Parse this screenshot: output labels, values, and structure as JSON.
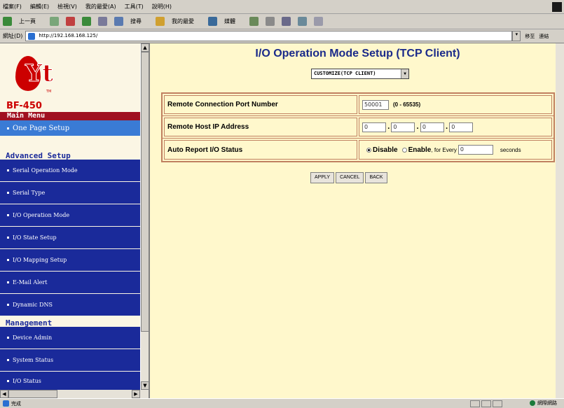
{
  "browser": {
    "menu_items": [
      "檔案(F)",
      "編輯(E)",
      "檢視(V)",
      "我的最愛(A)",
      "工具(T)",
      "說明(H)"
    ],
    "toolbar_back": "上一頁",
    "toolbar_items": [
      "搜尋",
      "我的最愛",
      "媒體"
    ],
    "address_label": "網址(D)",
    "address_url": "http://192.168.168.125/",
    "go_label": "移至",
    "links_label": "連結",
    "status_text": "完成",
    "zone_text": "網際網路"
  },
  "sidebar": {
    "logo_text": "Yt",
    "logo_tm": "TM",
    "model": "BF-450",
    "main_menu_label": "Main Menu",
    "main_items": [
      {
        "label": "One Page Setup"
      }
    ],
    "advanced_heading": "Advanced Setup",
    "advanced_items": [
      {
        "label": "Serial Operation Mode"
      },
      {
        "label": "Serial Type"
      },
      {
        "label": "I/O Operation Mode"
      },
      {
        "label": "I/O State Setup"
      },
      {
        "label": "I/O Mapping Setup"
      },
      {
        "label": "E-Mail Alert"
      },
      {
        "label": "Dynamic DNS"
      }
    ],
    "management_heading": "Management",
    "management_items": [
      {
        "label": "Device Admin"
      },
      {
        "label": "System Status"
      },
      {
        "label": "I/O Status"
      }
    ]
  },
  "main": {
    "title": "I/O Operation Mode Setup (TCP Client)",
    "mode_select": "CUSTOMIZE(TCP CLIENT)",
    "rows": {
      "port_label": "Remote Connection Port Number",
      "port_value": "50001",
      "port_range": "(0 - 65535)",
      "ip_label": "Remote Host  IP Address",
      "ip_octets": [
        "0",
        "0",
        "0",
        "0"
      ],
      "auto_label": "Auto Report I/O Status",
      "disable_label": "Disable",
      "enable_label": "Enable",
      "for_every_label": ", for Every",
      "interval_value": "0",
      "seconds_label": "seconds"
    },
    "buttons": {
      "apply": "APPLY",
      "cancel": "CANCEL",
      "back": "BACK"
    }
  },
  "colors": {
    "sidebar_item_bg": "#1a2a9a",
    "sidebar_selected_bg": "#3a7bd5",
    "main_menu_bg": "#a01020",
    "content_bg": "#fff8cc",
    "title_color": "#1a2a8a",
    "brand_red": "#cc0000"
  }
}
